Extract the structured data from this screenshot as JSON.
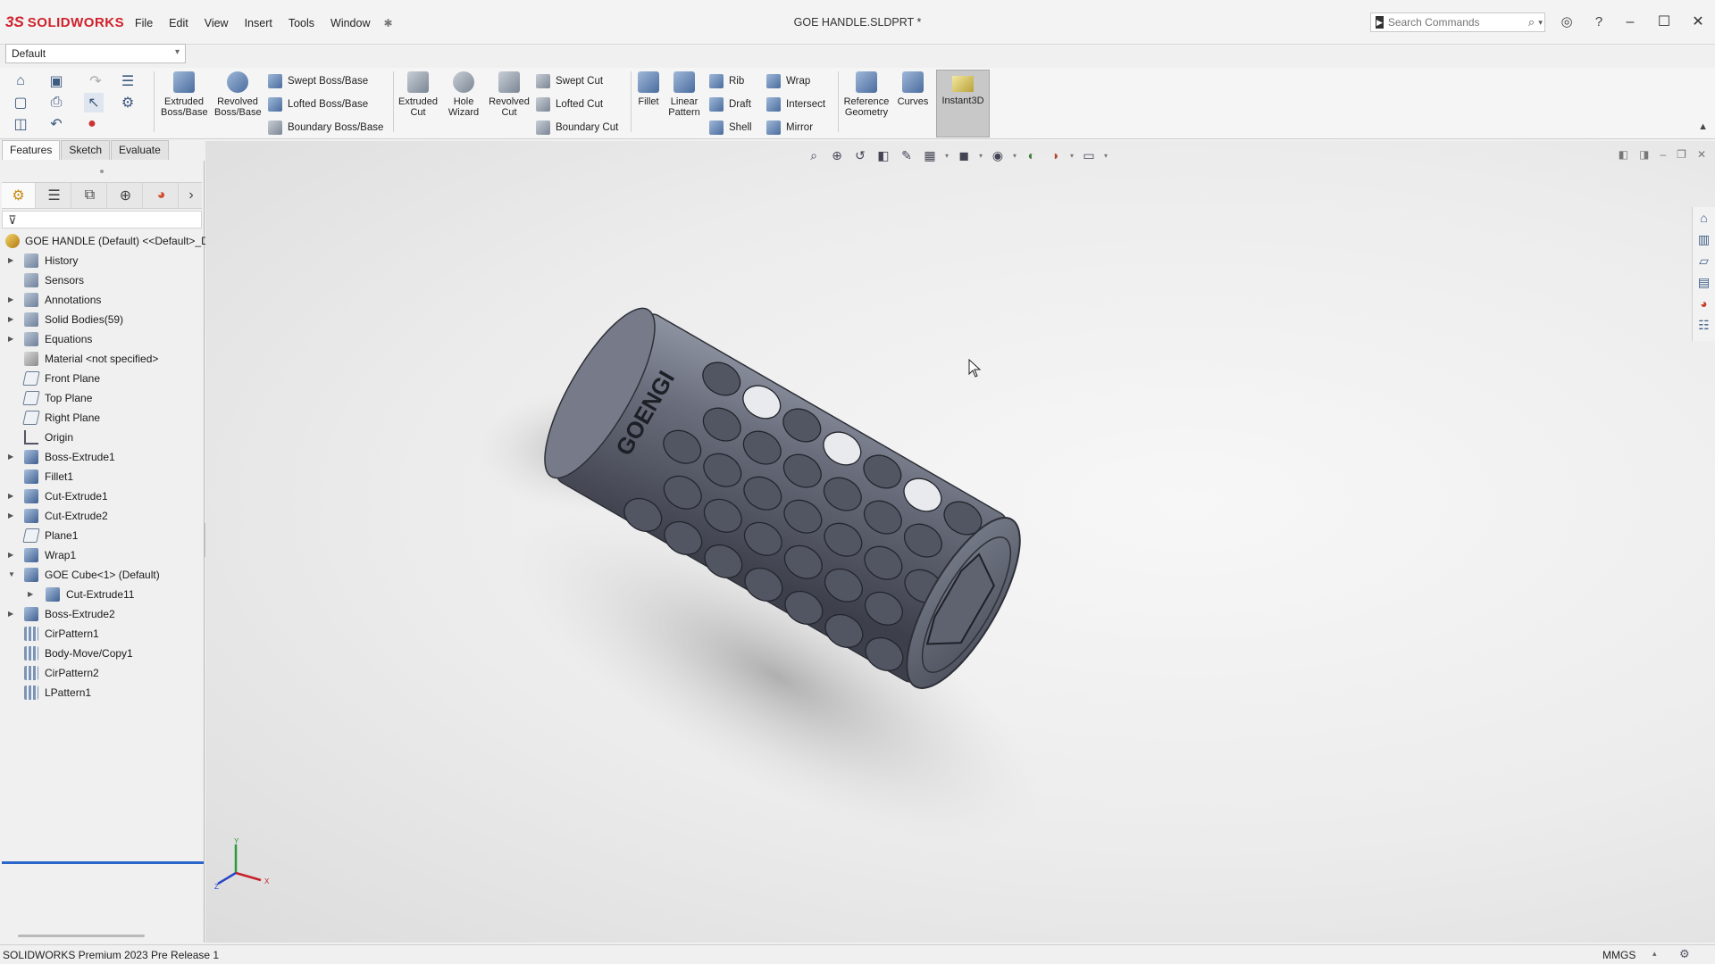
{
  "app": {
    "brand_mark": "3S",
    "brand_name": "SOLIDWORKS",
    "document_title": "GOE HANDLE.SLDPRT *"
  },
  "menu": {
    "items": [
      "File",
      "Edit",
      "View",
      "Insert",
      "Tools",
      "Window"
    ],
    "pin": "✱"
  },
  "search": {
    "placeholder": "Search Commands"
  },
  "configuration": {
    "selected": "Default"
  },
  "ribbon": {
    "extruded_boss": "Extruded Boss/Base",
    "revolved_boss": "Revolved Boss/Base",
    "swept_boss": "Swept Boss/Base",
    "lofted_boss": "Lofted Boss/Base",
    "boundary_boss": "Boundary Boss/Base",
    "extruded_cut": "Extruded Cut",
    "hole_wizard": "Hole Wizard",
    "revolved_cut": "Revolved Cut",
    "swept_cut": "Swept Cut",
    "lofted_cut": "Lofted Cut",
    "boundary_cut": "Boundary Cut",
    "fillet": "Fillet",
    "linear_pattern": "Linear Pattern",
    "rib": "Rib",
    "draft": "Draft",
    "shell": "Shell",
    "wrap": "Wrap",
    "intersect": "Intersect",
    "mirror": "Mirror",
    "reference_geometry": "Reference Geometry",
    "curves": "Curves",
    "instant3d": "Instant3D"
  },
  "command_tabs": [
    "Features",
    "Sketch",
    "Evaluate"
  ],
  "feature_tree": {
    "root": "GOE HANDLE (Default) <<Default>_D",
    "items": [
      {
        "label": "History",
        "icon": "folder",
        "expandable": true
      },
      {
        "label": "Sensors",
        "icon": "folder",
        "expandable": false
      },
      {
        "label": "Annotations",
        "icon": "folder",
        "expandable": true
      },
      {
        "label": "Solid Bodies(59)",
        "icon": "folder",
        "expandable": true
      },
      {
        "label": "Equations",
        "icon": "folder",
        "expandable": true
      },
      {
        "label": "Material <not specified>",
        "icon": "material",
        "expandable": false
      },
      {
        "label": "Front Plane",
        "icon": "plane",
        "expandable": false
      },
      {
        "label": "Top Plane",
        "icon": "plane",
        "expandable": false
      },
      {
        "label": "Right Plane",
        "icon": "plane",
        "expandable": false
      },
      {
        "label": "Origin",
        "icon": "origin",
        "expandable": false
      },
      {
        "label": "Boss-Extrude1",
        "icon": "feature",
        "expandable": true
      },
      {
        "label": "Fillet1",
        "icon": "feature",
        "expandable": false
      },
      {
        "label": "Cut-Extrude1",
        "icon": "feature",
        "expandable": true
      },
      {
        "label": "Cut-Extrude2",
        "icon": "feature",
        "expandable": true
      },
      {
        "label": "Plane1",
        "icon": "plane",
        "expandable": false
      },
      {
        "label": "Wrap1",
        "icon": "feature",
        "expandable": true
      },
      {
        "label": "GOE Cube<1> (Default)",
        "icon": "feature",
        "expandable": true,
        "expanded": true
      },
      {
        "label": "Cut-Extrude11",
        "icon": "feature",
        "expandable": true,
        "child": true
      },
      {
        "label": "Boss-Extrude2",
        "icon": "feature",
        "expandable": true
      },
      {
        "label": "CirPattern1",
        "icon": "pattern",
        "expandable": false
      },
      {
        "label": "Body-Move/Copy1",
        "icon": "pattern",
        "expandable": false
      },
      {
        "label": "CirPattern2",
        "icon": "pattern",
        "expandable": false
      },
      {
        "label": "LPattern1",
        "icon": "pattern",
        "expandable": false
      }
    ]
  },
  "model": {
    "engraved_text": "GOENGI",
    "body_color": "#5d6170",
    "highlight_color": "#8f94a3"
  },
  "triad": {
    "x": "X",
    "y": "Y",
    "z": "Z"
  },
  "status": {
    "text": "SOLIDWORKS Premium 2023 Pre Release 1",
    "units": "MMGS"
  },
  "colors": {
    "accent": "#d0202a",
    "rollback": "#2a66c9"
  }
}
